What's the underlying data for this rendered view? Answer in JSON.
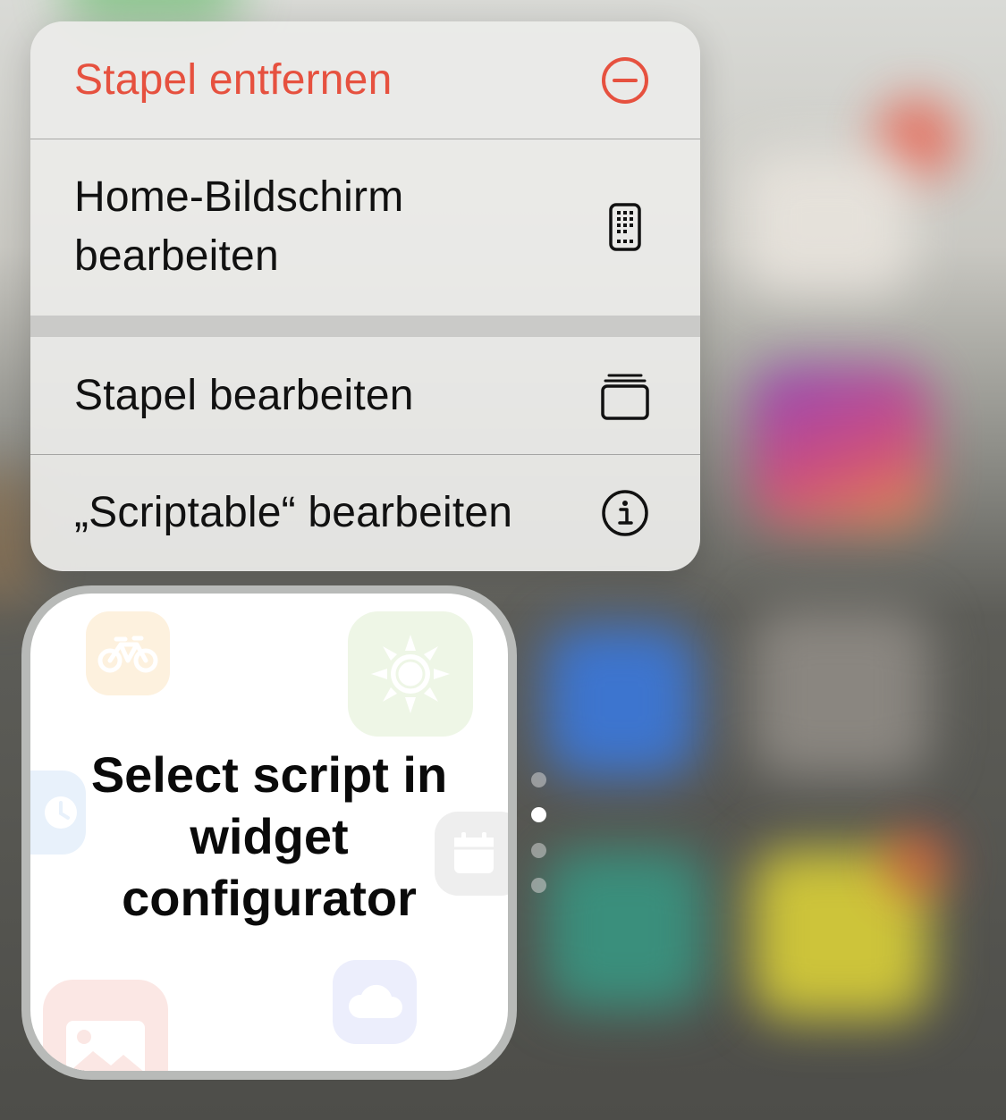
{
  "context_menu": {
    "items": [
      {
        "label": "Stapel entfernen",
        "icon": "minus-circle-icon",
        "destructive": true
      },
      {
        "label_line1": "Home-Bildschirm",
        "label_line2": "bearbeiten",
        "icon": "iphone-icon"
      },
      {
        "label": "Stapel bearbeiten",
        "icon": "stack-icon"
      },
      {
        "label": "„Scriptable“ bearbeiten",
        "icon": "info-icon"
      }
    ],
    "destructive_color": "#e6513f"
  },
  "widget": {
    "message_line1": "Select script in",
    "message_line2": "widget",
    "message_line3": "configurator",
    "ghost_icons": [
      "bicycle-icon",
      "sun-icon",
      "clock-icon",
      "calendar-icon",
      "photo-icon",
      "cloud-icon"
    ]
  },
  "page_indicator": {
    "count": 4,
    "active_index": 1
  }
}
